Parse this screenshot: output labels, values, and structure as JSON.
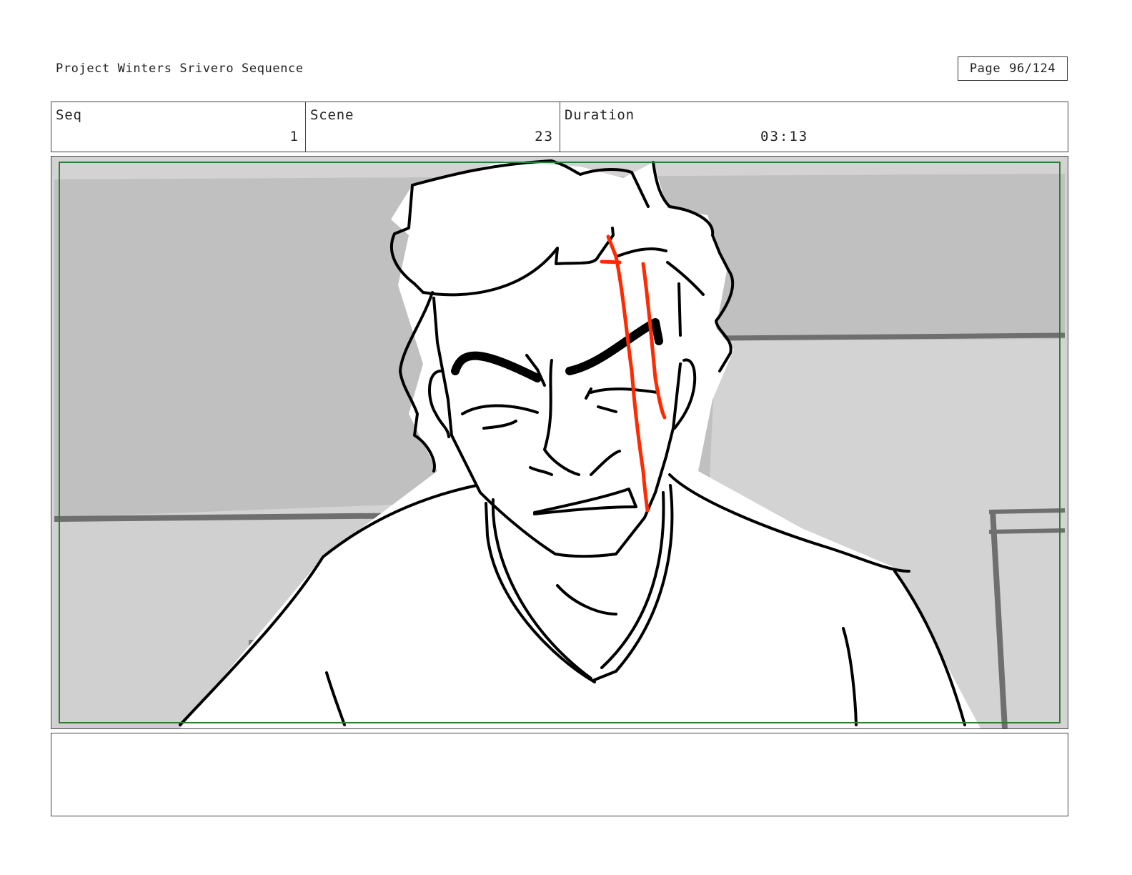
{
  "header": {
    "project_title": "Project Winters Srivero Sequence",
    "page_label": "Page",
    "page_number": "96/124"
  },
  "info": {
    "seq_label": "Seq",
    "seq_value": "1",
    "scene_label": "Scene",
    "scene_value": "23",
    "duration_label": "Duration",
    "duration_value": "03:13"
  },
  "panel": {
    "safe_area_color": "#2e7d32",
    "blood_color": "#ff2a00",
    "background_gray": "#c4c4c4"
  },
  "notes": {
    "text": ""
  }
}
